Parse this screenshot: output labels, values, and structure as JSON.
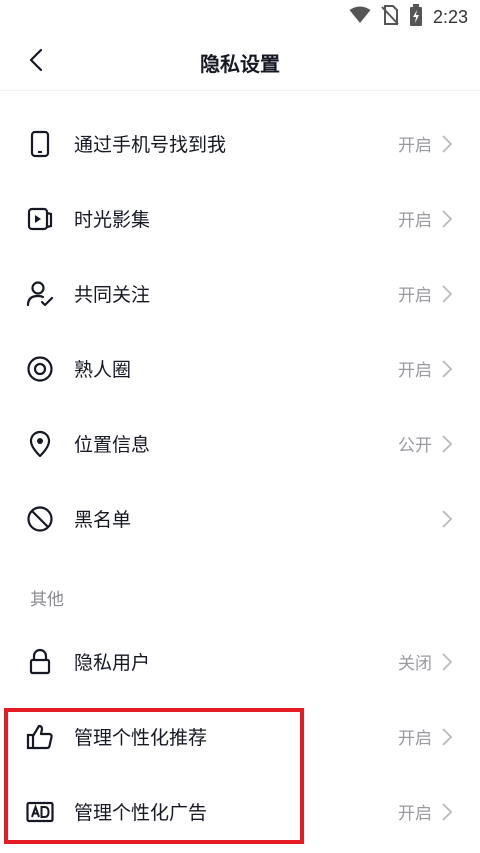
{
  "status_bar": {
    "time": "2:23",
    "icons": [
      "wifi-icon",
      "no-sim-icon",
      "battery-charging-icon"
    ]
  },
  "header": {
    "title": "隐私设置"
  },
  "settings": [
    {
      "label": "通过手机号找到我",
      "value": "开启",
      "icon": "phone-icon"
    },
    {
      "label": "时光影集",
      "value": "开启",
      "icon": "album-icon"
    },
    {
      "label": "共同关注",
      "value": "开启",
      "icon": "user-check-icon"
    },
    {
      "label": "熟人圈",
      "value": "开启",
      "icon": "circle-icon"
    },
    {
      "label": "位置信息",
      "value": "公开",
      "icon": "location-pin-icon"
    },
    {
      "label": "黑名单",
      "value": "",
      "icon": "block-icon"
    }
  ],
  "other_section": {
    "header": "其他",
    "items": [
      {
        "label": "隐私用户",
        "value": "关闭",
        "icon": "lock-icon"
      },
      {
        "label": "管理个性化推荐",
        "value": "开启",
        "icon": "thumbs-up-icon"
      },
      {
        "label": "管理个性化广告",
        "value": "开启",
        "icon": "ad-icon"
      }
    ]
  },
  "colors": {
    "highlight": "#e51b23",
    "text_primary": "#161823",
    "text_secondary": "#999aa0"
  }
}
